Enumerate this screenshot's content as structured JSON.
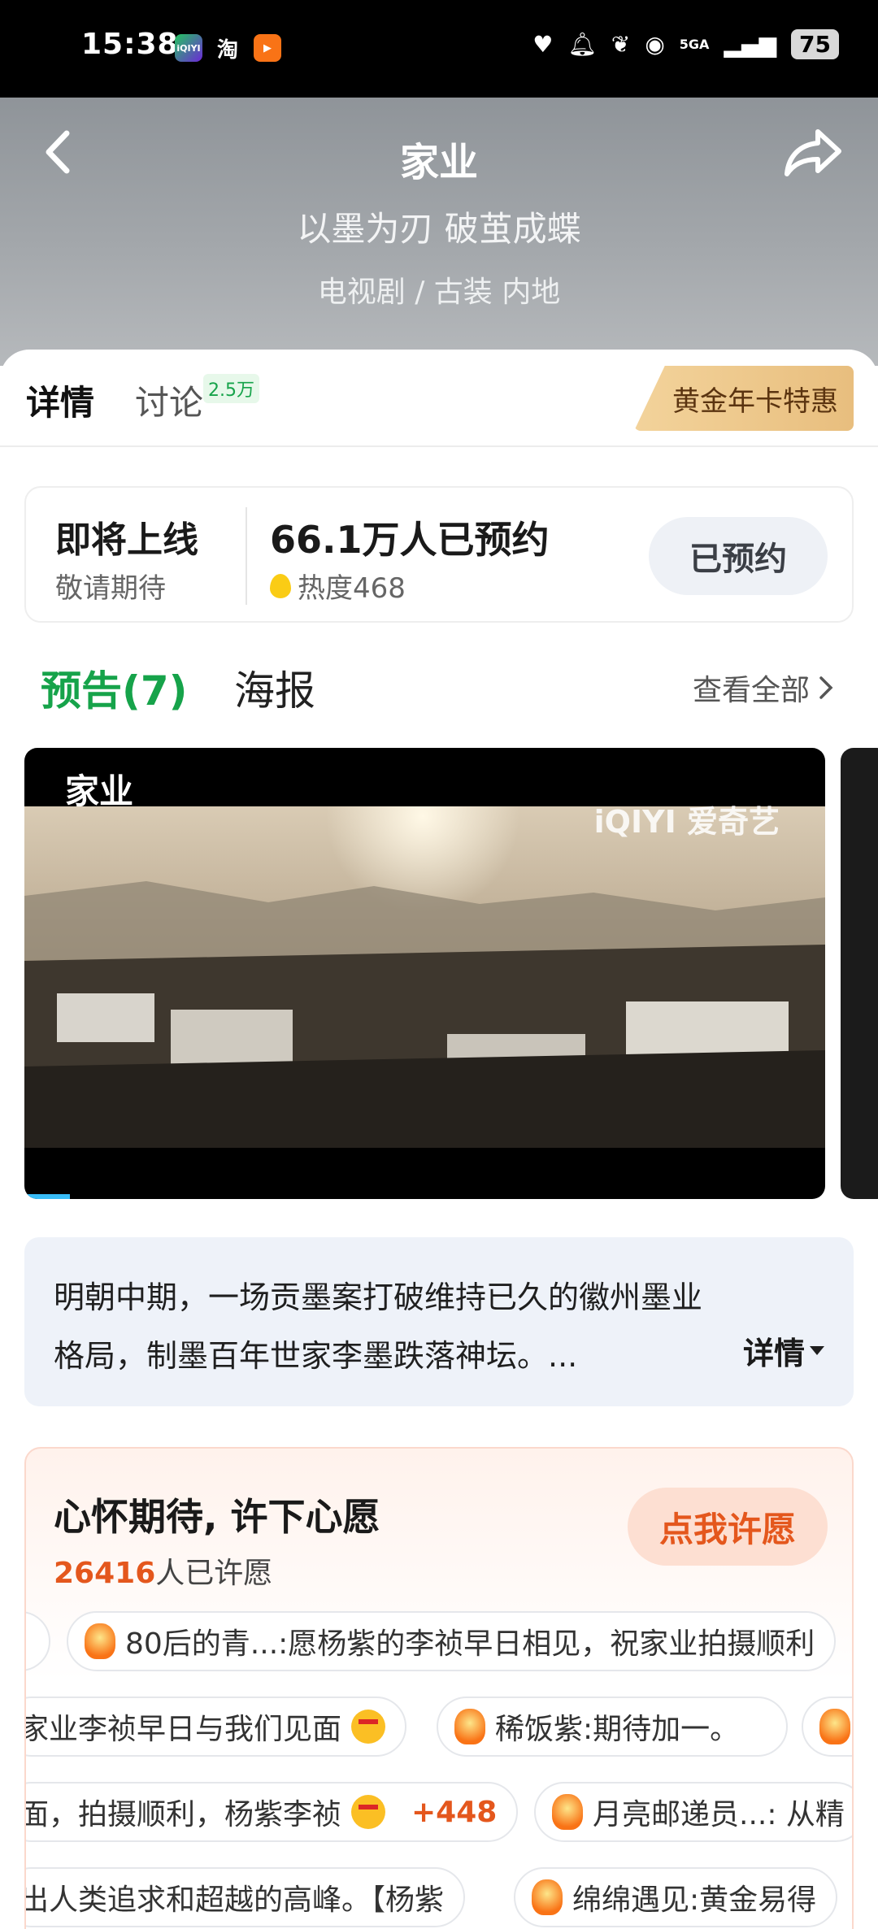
{
  "status_bar": {
    "time": "15:38",
    "apps": [
      "iQIYI",
      "淘",
      "video"
    ],
    "network": "5GA",
    "battery": "75"
  },
  "header": {
    "title": "家业",
    "slogan": "以墨为刃 破茧成蝶",
    "genre": "电视剧 / 古装 内地"
  },
  "tabs": {
    "details": "详情",
    "discuss": "讨论",
    "discuss_badge": "2.5万",
    "vip_button": "黄金年卡特惠"
  },
  "release": {
    "status": "即将上线",
    "sub": "敬请期待",
    "reservations": "66.1万人已预约",
    "heat": "热度468",
    "reserve_button": "已预约"
  },
  "media_section": {
    "trailer_tab": "预告(7)",
    "poster_tab": "海报",
    "view_all": "查看全部"
  },
  "video": {
    "title": "家业",
    "watermark": "iQIYI 爱奇艺"
  },
  "synopsis": {
    "text": "明朝中期，一场贡墨案打破维持已久的徽州墨业格局，制墨百年世家李墨跌落神坛。...",
    "more": "详情"
  },
  "wish": {
    "title": "心怀期待, 许下心愿",
    "count": "26416",
    "count_suffix": "人已许愿",
    "button": "点我许愿",
    "bubbles": [
      "80后的青...:愿杨紫的李祯早日相见，祝家业拍摄顺利",
      "家业李祯早日与我们见面",
      "稀饭紫:期待加一。",
      "面，拍摄顺利，杨紫李祯",
      "+448",
      "月亮邮递员...: 从精",
      "出人类追求和超越的高峰。【杨紫",
      "绵绵遇见:黄金易得"
    ]
  },
  "colors": {
    "accent_green": "#16a34a",
    "wish_orange": "#e4571d",
    "vip_gold": "#f3d39b"
  }
}
